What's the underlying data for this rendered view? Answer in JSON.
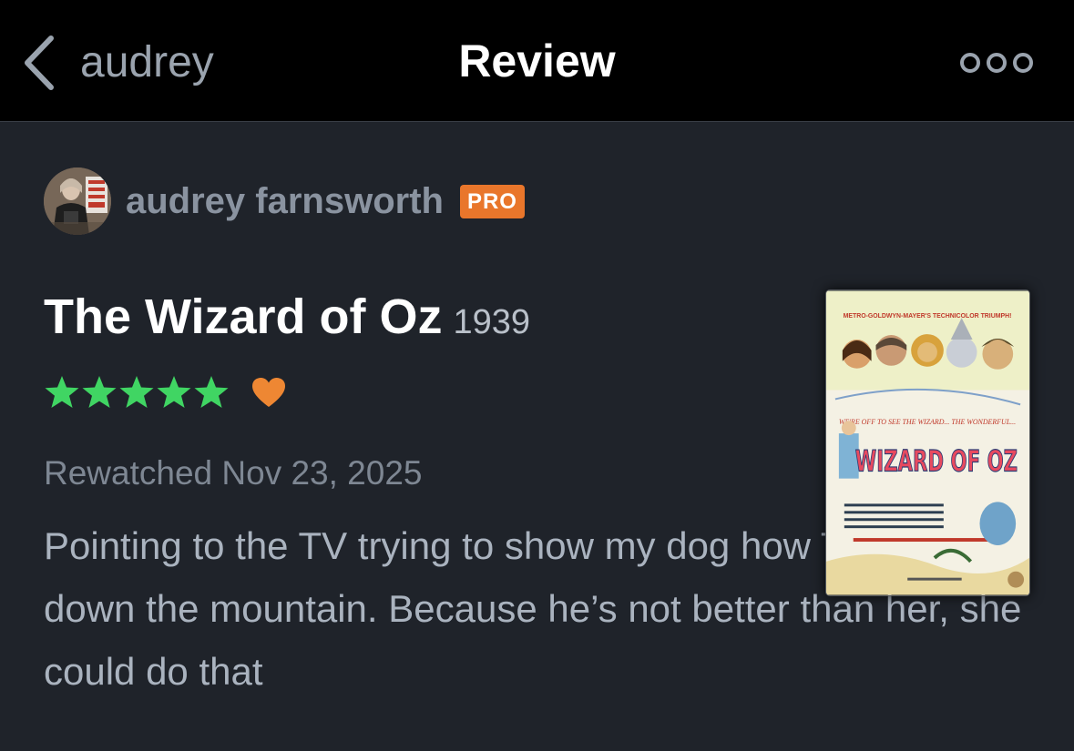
{
  "header": {
    "back_label": "audrey",
    "title": "Review",
    "more_icon": "more-horizontal-icon"
  },
  "review": {
    "author_name": "audrey farnsworth",
    "badge": "PRO",
    "film_title": "The Wizard of Oz",
    "film_year": "1939",
    "rating_stars": 5,
    "liked": true,
    "watch_date": "Rewatched Nov 23, 2025",
    "text": "Pointing to the TV trying to show my dog how Toto walks down the mountain. Because he’s not better than her, she could do that"
  },
  "poster": {
    "studio_line": "METRO-GOLDWYN-MAYER'S TECHNICOLOR TRIUMPH!",
    "tagline": "WE'RE OFF TO SEE THE WIZARD... THE WONDERFUL...",
    "wordmark": "WIZARD OF OZ"
  },
  "colors": {
    "background": "#1f232a",
    "topbar": "#000000",
    "star": "#40d563",
    "heart": "#ee8733",
    "pro_badge": "#e9762b"
  }
}
